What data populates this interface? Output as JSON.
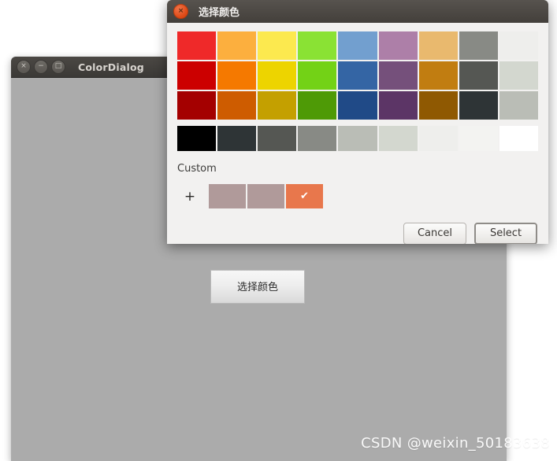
{
  "background_window": {
    "title": "ColorDialog",
    "controls": [
      {
        "name": "close",
        "glyph": "×"
      },
      {
        "name": "minimize",
        "glyph": "−"
      },
      {
        "name": "maximize",
        "glyph": "□"
      }
    ],
    "pick_color_button": "选择颜色",
    "body_color": "#ababab"
  },
  "watermark": "CSDN @weixin_50183638",
  "dialog": {
    "title": "选择颜色",
    "close_glyph": "×",
    "custom_label": "Custom",
    "add_custom_glyph": "+",
    "palette": [
      [
        "#ef2929",
        "#fcaf3e",
        "#fce94f",
        "#8ae234",
        "#729fcf",
        "#ad7fa8",
        "#e9b96e",
        "#888a85",
        "#eeeeec"
      ],
      [
        "#cc0000",
        "#f57900",
        "#edd400",
        "#73d216",
        "#3465a4",
        "#75507b",
        "#c17d11",
        "#555753",
        "#d3d7cf"
      ],
      [
        "#a40000",
        "#ce5c00",
        "#c4a000",
        "#4e9a06",
        "#204a87",
        "#5c3566",
        "#8f5902",
        "#2e3436",
        "#babdb6"
      ]
    ],
    "grayscale": [
      "#000000",
      "#2e3436",
      "#555753",
      "#888a85",
      "#babdb6",
      "#d3d7cf",
      "#eeeeec",
      "#f3f3f1",
      "#ffffff"
    ],
    "custom_swatches": [
      {
        "color": "#b09a9a",
        "selected": false
      },
      {
        "color": "#b09a9a",
        "selected": false
      },
      {
        "color": "#e8774c",
        "selected": true,
        "check_glyph": "✔"
      }
    ],
    "buttons": {
      "cancel": "Cancel",
      "select": "Select"
    }
  }
}
